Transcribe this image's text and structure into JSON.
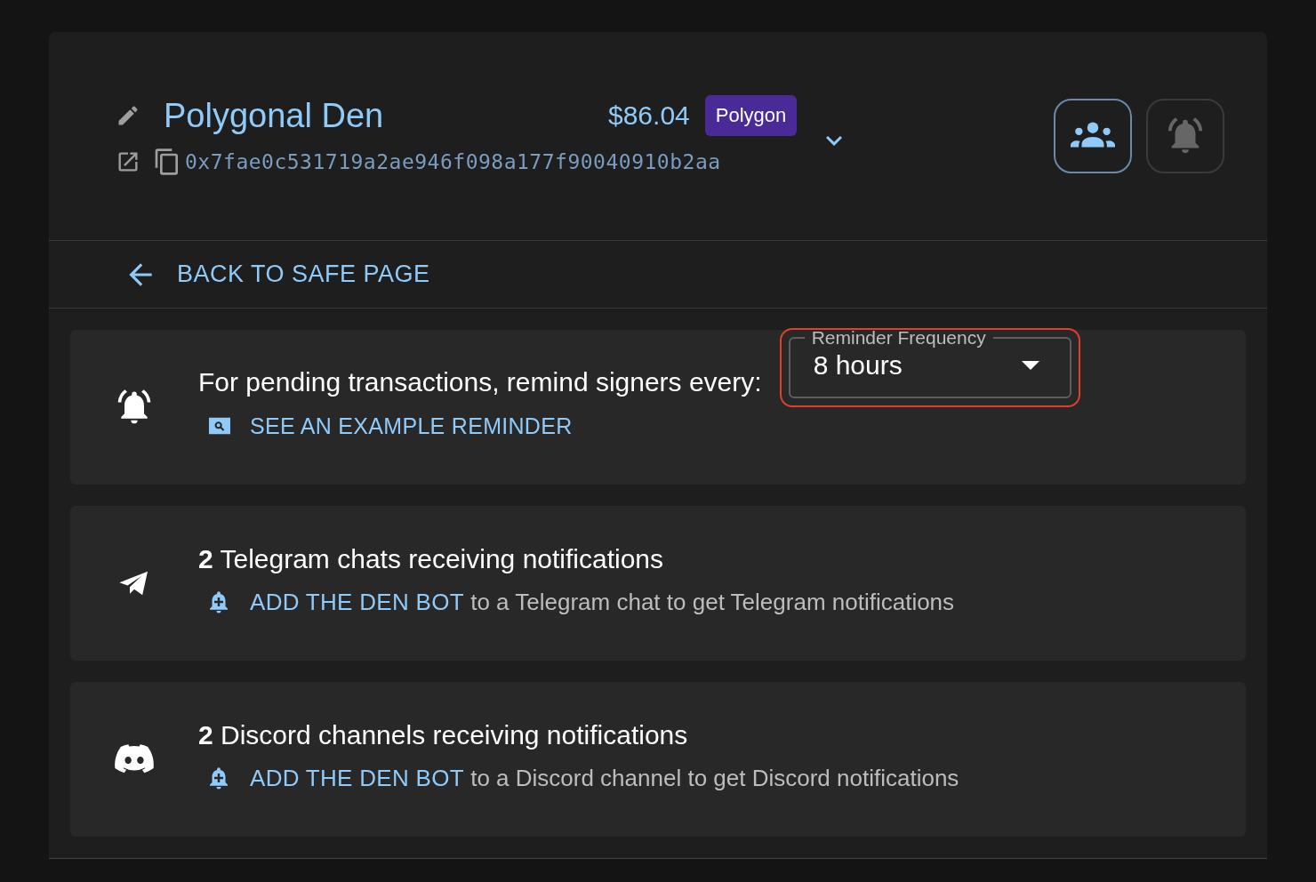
{
  "header": {
    "name": "Polygonal Den",
    "balance": "$86.04",
    "network": "Polygon",
    "address": "0x7fae0c531719a2ae946f098a177f90040910b2aa",
    "expanded": false,
    "actions": [
      {
        "kind": "members",
        "selected": true
      },
      {
        "kind": "bell",
        "selected": false
      }
    ]
  },
  "back_link": "BACK TO SAFE PAGE",
  "cards": [
    {
      "kind": "reminder",
      "title": "For pending transactions, remind signers every:",
      "link": "SEE AN EXAMPLE REMINDER",
      "select": {
        "label": "Reminder Frequency",
        "value": "8 hours",
        "highlighted": true
      }
    },
    {
      "kind": "telegram",
      "title": "**2** Telegram chats receiving notifications",
      "link": "ADD THE DEN BOT",
      "rest": "to a Telegram chat to get Telegram notifications"
    },
    {
      "kind": "discord",
      "title": "**2** Discord channels receiving notifications",
      "link": "ADD THE DEN BOT",
      "rest": "to a Discord channel to get Discord notifications"
    }
  ]
}
